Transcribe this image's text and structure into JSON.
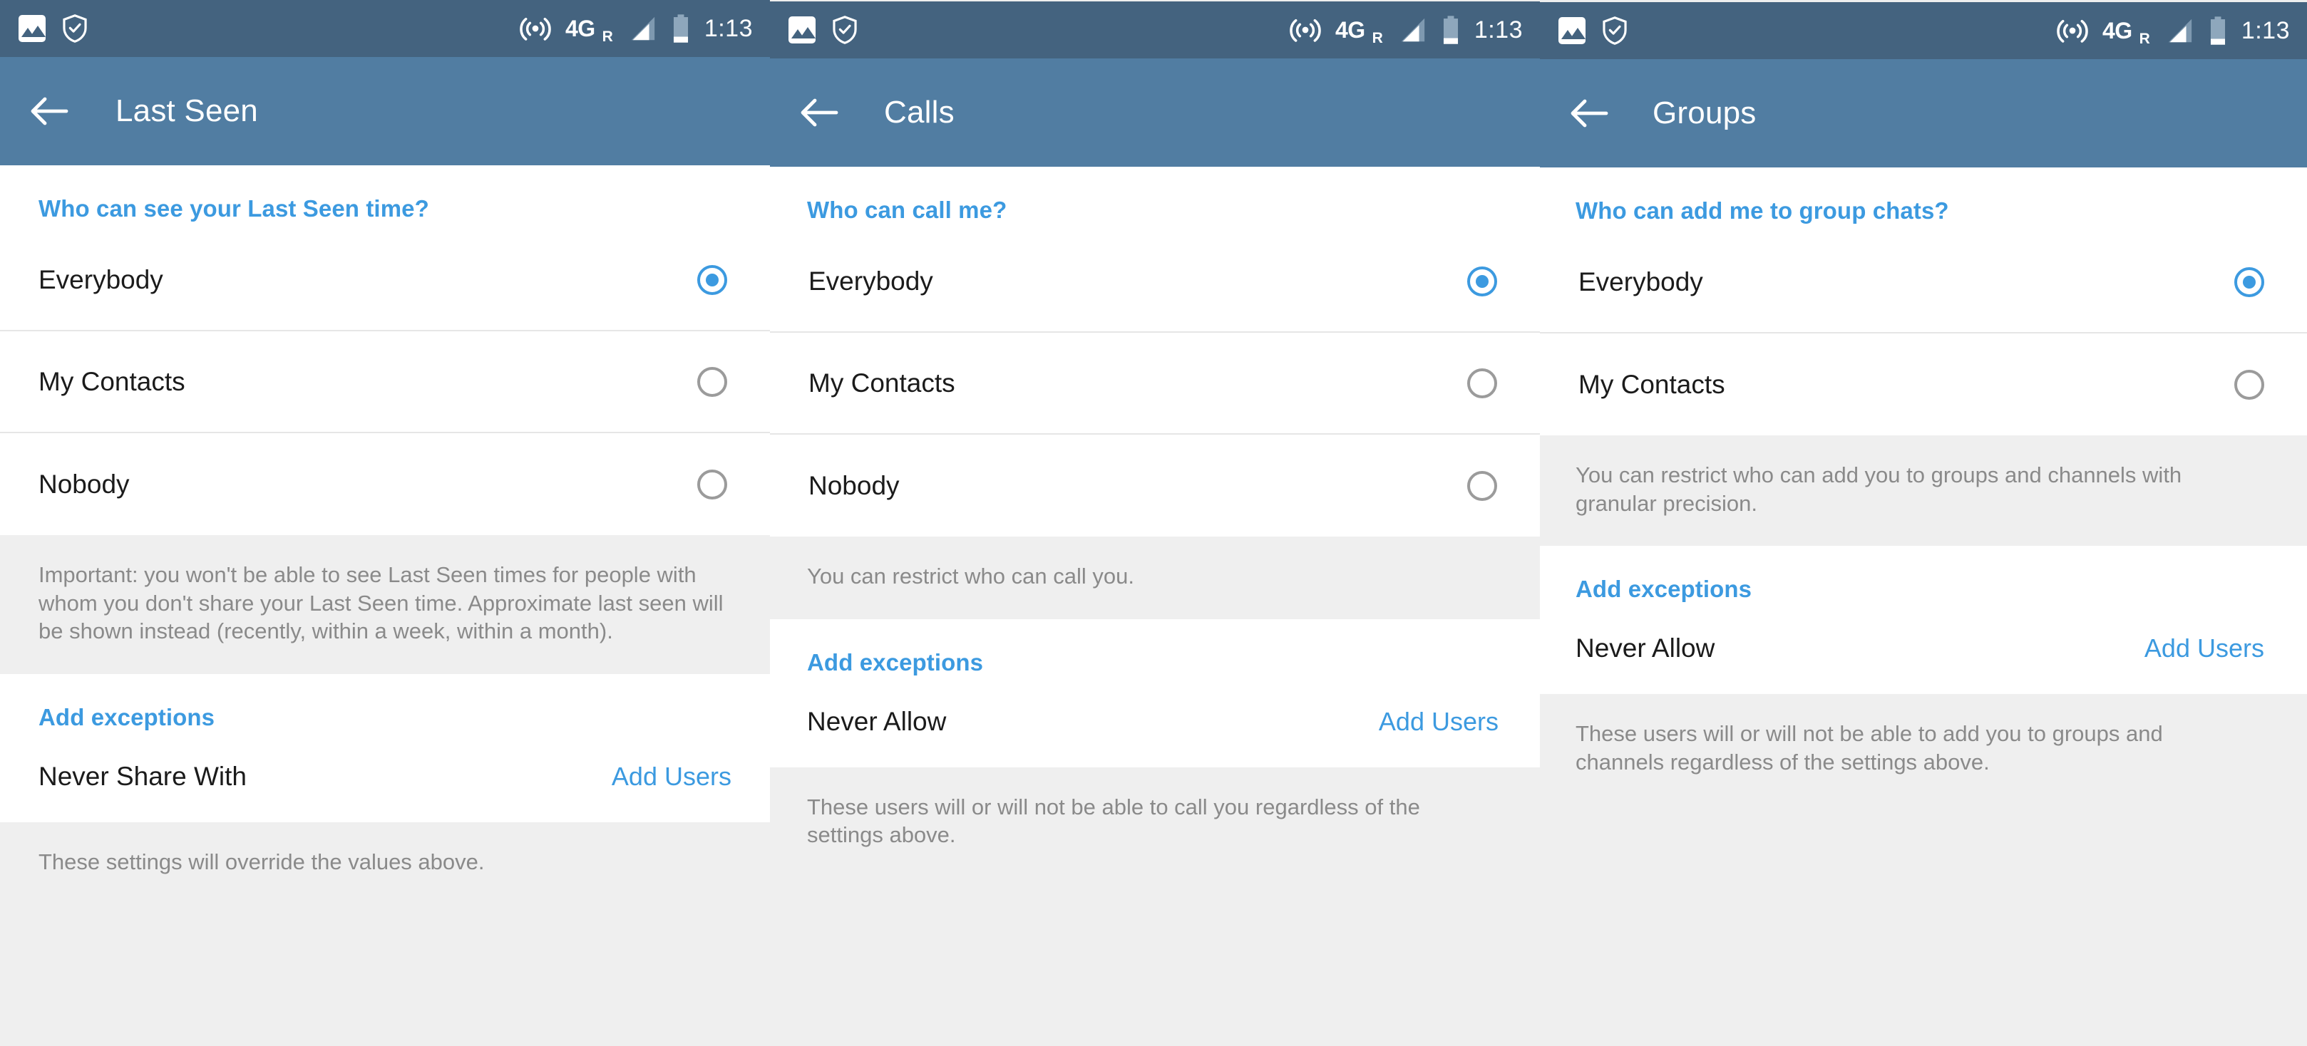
{
  "status_bar": {
    "icons": [
      "image-icon",
      "shield-check-icon",
      "hotspot-icon",
      "signal-triangle-icon",
      "battery-icon"
    ],
    "network_label": "4G",
    "roaming_label": "R",
    "clock": "1:13"
  },
  "colors": {
    "status_bar_bg": "#44637f",
    "app_bar_bg": "#517da2",
    "accent": "#3c9ae0",
    "page_bg": "#efefef",
    "card_bg": "#ffffff",
    "primary_text": "#1b1b1b",
    "secondary_text": "#8a8a8a"
  },
  "panels": [
    {
      "title": "Last Seen",
      "back_icon": "back-arrow-icon",
      "section_header": "Who can see your Last Seen time?",
      "options": [
        {
          "label": "Everybody",
          "selected": true
        },
        {
          "label": "My Contacts",
          "selected": false
        },
        {
          "label": "Nobody",
          "selected": false
        }
      ],
      "note": "Important: you won't be able to see Last Seen times for people with whom you don't share your Last Seen time. Approximate last seen will be shown instead (recently, within a week, within a month).",
      "exceptions_header": "Add exceptions",
      "exception_label": "Never Share With",
      "exception_action": "Add Users",
      "exception_note": "These settings will override the values above."
    },
    {
      "title": "Calls",
      "back_icon": "back-arrow-icon",
      "section_header": "Who can call me?",
      "options": [
        {
          "label": "Everybody",
          "selected": true
        },
        {
          "label": "My Contacts",
          "selected": false
        },
        {
          "label": "Nobody",
          "selected": false
        }
      ],
      "note": "You can restrict who can call you.",
      "exceptions_header": "Add exceptions",
      "exception_label": "Never Allow",
      "exception_action": "Add Users",
      "exception_note": "These users will or will not be able to call you regardless of the settings above."
    },
    {
      "title": "Groups",
      "back_icon": "back-arrow-icon",
      "section_header": "Who can add me to group chats?",
      "options": [
        {
          "label": "Everybody",
          "selected": true
        },
        {
          "label": "My Contacts",
          "selected": false
        }
      ],
      "note": "You can restrict who can add you to groups and channels with granular precision.",
      "exceptions_header": "Add exceptions",
      "exception_label": "Never Allow",
      "exception_action": "Add Users",
      "exception_note": "These users will or will not be able to add you to groups and channels regardless of the settings above."
    }
  ]
}
